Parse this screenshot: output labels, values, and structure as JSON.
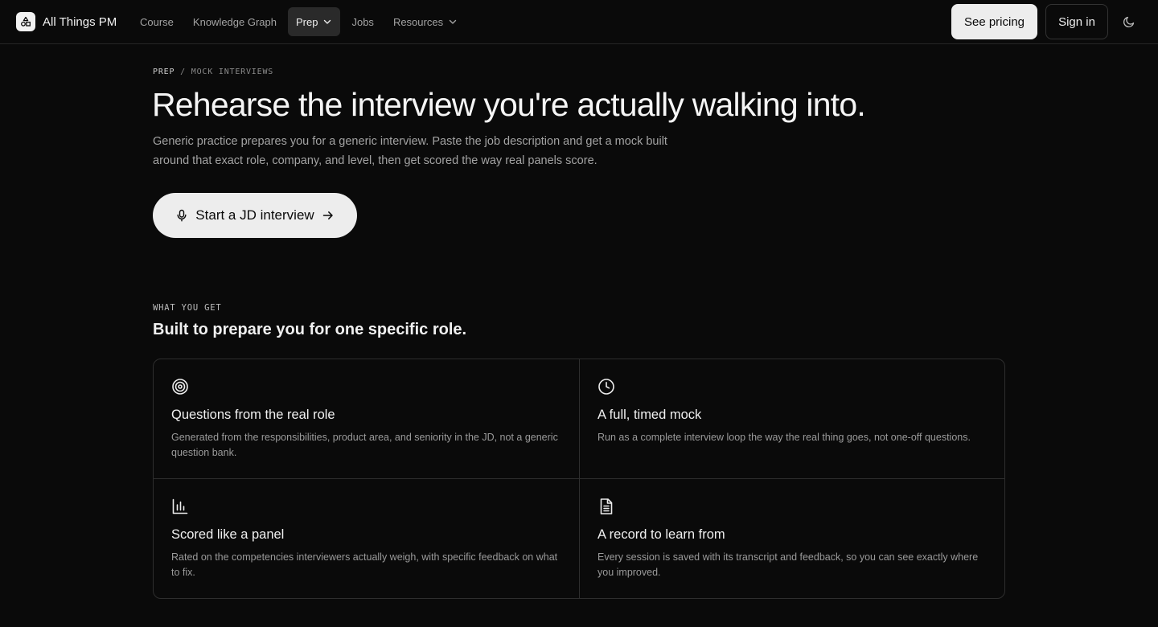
{
  "header": {
    "brand": "All Things PM",
    "nav": [
      {
        "label": "Course"
      },
      {
        "label": "Knowledge Graph"
      },
      {
        "label": "Prep"
      },
      {
        "label": "Jobs"
      },
      {
        "label": "Resources"
      }
    ],
    "pricing_label": "See pricing",
    "signin_label": "Sign in",
    "theme_icon": "moon-icon"
  },
  "breadcrumb": {
    "parent": "PREP",
    "separator": "/",
    "current": "MOCK INTERVIEWS"
  },
  "hero": {
    "title": "Rehearse the interview you're actually walking into.",
    "subtitle": "Generic practice prepares you for a generic interview. Paste the job description and get a mock built around that exact role, company, and level, then get scored the way real panels score.",
    "cta_label": "Start a JD interview"
  },
  "features": {
    "label": "WHAT YOU GET",
    "title": "Built to prepare you for one specific role.",
    "cards": [
      {
        "icon": "target-icon",
        "title": "Questions from the real role",
        "desc": "Generated from the responsibilities, product area, and seniority in the JD, not a generic question bank."
      },
      {
        "icon": "clock-icon",
        "title": "A full, timed mock",
        "desc": "Run as a complete interview loop the way the real thing goes, not one-off questions."
      },
      {
        "icon": "bar-chart-icon",
        "title": "Scored like a panel",
        "desc": "Rated on the competencies interviewers actually weigh, with specific feedback on what to fix."
      },
      {
        "icon": "document-icon",
        "title": "A record to learn from",
        "desc": "Every session is saved with its transcript and feedback, so you can see exactly where you improved."
      }
    ]
  },
  "colors": {
    "background": "#0a0a0a",
    "text": "#ededed",
    "muted": "#a3a3a3",
    "border": "#2e2e2e",
    "button_light": "#ededed"
  }
}
